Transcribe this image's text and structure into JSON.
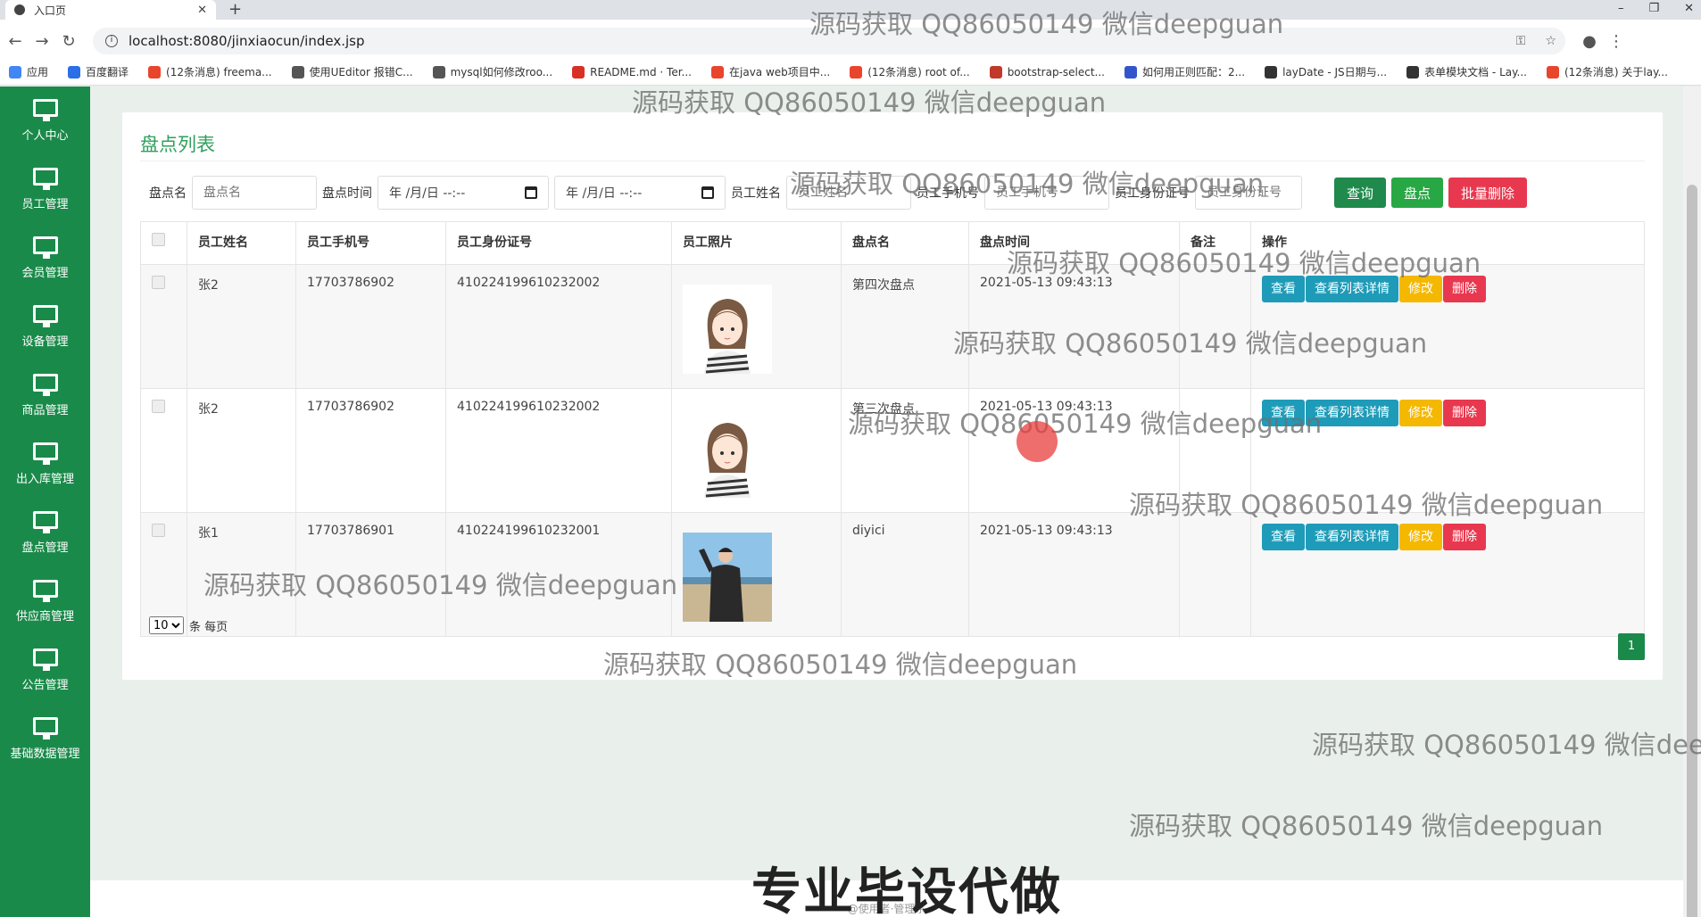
{
  "browser": {
    "tab_title": "入口页",
    "tab_close": "✕",
    "new_tab": "+",
    "url": "localhost:8080/jinxiaocun/index.jsp",
    "window_buttons": [
      "–",
      "❐",
      "✕"
    ],
    "bookmarks": [
      {
        "label": "应用",
        "color": "#4285f4"
      },
      {
        "label": "百度翻译",
        "color": "#2a6ee8"
      },
      {
        "label": "(12条消息) freema...",
        "color": "#e8452c"
      },
      {
        "label": "使用UEditor 报错C...",
        "color": "#555555"
      },
      {
        "label": "mysql如何修改roo...",
        "color": "#555555"
      },
      {
        "label": "README.md · Ter...",
        "color": "#d93025"
      },
      {
        "label": "在java web项目中...",
        "color": "#e8452c"
      },
      {
        "label": "(12条消息) root of...",
        "color": "#e8452c"
      },
      {
        "label": "bootstrap-select...",
        "color": "#c0392b"
      },
      {
        "label": "如何用正则匹配：2...",
        "color": "#3355cc"
      },
      {
        "label": "layDate - JS日期与...",
        "color": "#333333"
      },
      {
        "label": "表单模块文档 - Lay...",
        "color": "#333333"
      },
      {
        "label": "(12条消息) 关于lay...",
        "color": "#e8452c"
      }
    ]
  },
  "sidebar": {
    "items": [
      {
        "label": "个人中心"
      },
      {
        "label": "员工管理"
      },
      {
        "label": "会员管理"
      },
      {
        "label": "设备管理"
      },
      {
        "label": "商品管理"
      },
      {
        "label": "出入库管理"
      },
      {
        "label": "盘点管理"
      },
      {
        "label": "供应商管理"
      },
      {
        "label": "公告管理"
      },
      {
        "label": "基础数据管理"
      }
    ]
  },
  "panel": {
    "title": "盘点列表",
    "search": {
      "name_label": "盘点名",
      "name_placeholder": "盘点名",
      "time_label": "盘点时间",
      "date_start": "年 /月/日 --:--",
      "date_end": "年 /月/日 --:--",
      "emp_name_label": "员工姓名",
      "emp_name_placeholder": "员工姓名",
      "phone_label": "员工手机号",
      "phone_placeholder": "员工手机号",
      "idcard_label": "员工身份证号",
      "idcard_placeholder": "员工身份证号",
      "query_button": "查询",
      "inventory_button": "盘点",
      "batch_delete_button": "批量删除"
    },
    "table": {
      "headers": [
        "员工姓名",
        "员工手机号",
        "员工身份证号",
        "员工照片",
        "盘点名",
        "盘点时间",
        "备注",
        "操作"
      ],
      "rows": [
        {
          "name": "张2",
          "phone": "17703786902",
          "idcard": "410224199610232002",
          "photo": "girl",
          "check_name": "第四次盘点",
          "time": "2021-05-13 09:43:13",
          "note": ""
        },
        {
          "name": "张2",
          "phone": "17703786902",
          "idcard": "410224199610232002",
          "photo": "girl",
          "check_name": "第三次盘点",
          "time": "2021-05-13 09:43:13",
          "note": ""
        },
        {
          "name": "张1",
          "phone": "17703786901",
          "idcard": "410224199610232001",
          "photo": "man",
          "check_name": "diyici",
          "time": "2021-05-13 09:43:13",
          "note": ""
        }
      ],
      "actions": {
        "view": "查看",
        "view_detail": "查看列表详情",
        "edit": "修改",
        "delete": "删除"
      }
    },
    "pager": {
      "page_size": "10",
      "per_page_text": "条 每页",
      "current_page": "1"
    }
  },
  "banner": "专业毕设代做",
  "footer": "@使用者·管理系",
  "watermark": "源码获取 QQ86050149 微信deepguan",
  "colors": {
    "sidebar": "#1a8a4a",
    "title": "#2fa05c",
    "view": "#1e9bb8",
    "edit": "#f5b800",
    "delete": "#e8384f"
  }
}
